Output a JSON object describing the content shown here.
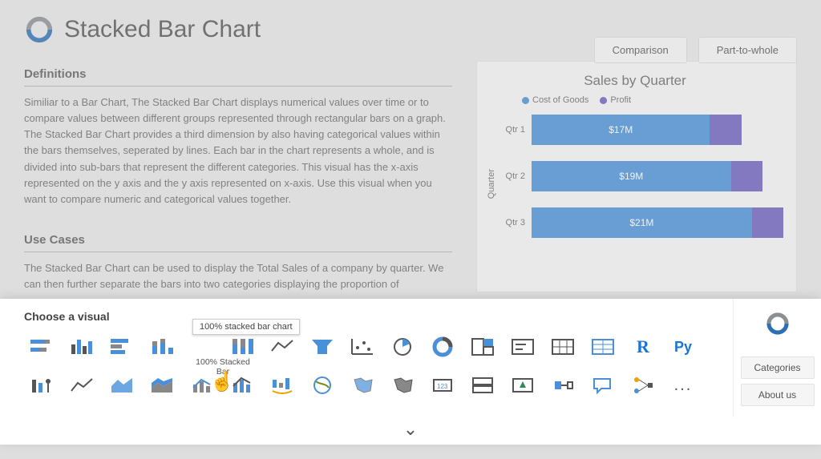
{
  "header": {
    "title": "Stacked Bar Chart",
    "buttons": {
      "comparison": "Comparison",
      "part_to_whole": "Part-to-whole"
    }
  },
  "sections": {
    "definitions_h": "Definitions",
    "definitions_body": "Similiar to a Bar Chart, The Stacked Bar Chart displays numerical values over time or to compare values between different groups represented through rectangular bars on a graph. The Stacked Bar Chart provides a third dimension by also having categorical values within the bars themselves, seperated by lines. Each bar in the chart represents a whole, and is divided into sub-bars that represent the different categories. This visual has the x-axis represented on the y axis and the y axis represented on x-axis. Use this visual when you want to compare numeric and categorical values together.",
    "usecases_h": "Use Cases",
    "usecases_body": "The Stacked Bar Chart can be used to display the Total Sales of a company by quarter. We can then further separate the bars into two categories displaying the proportion of"
  },
  "chooser": {
    "title": "Choose a visual",
    "tooltip": "100% stacked bar chart",
    "hover_label": "100% Stacked Bar",
    "r_label": "R",
    "py_label": "Py",
    "more": "...",
    "side": {
      "categories": "Categories",
      "about": "About us"
    }
  },
  "chart_data": {
    "type": "bar",
    "orientation": "horizontal",
    "stacked": true,
    "title": "Sales by Quarter",
    "ylabel": "Quarter",
    "categories": [
      "Qtr 1",
      "Qtr 2",
      "Qtr 3"
    ],
    "series": [
      {
        "name": "Cost of Goods",
        "color": "#4a90d9",
        "values": [
          17,
          19,
          21
        ],
        "labels": [
          "$17M",
          "$19M",
          "$21M"
        ]
      },
      {
        "name": "Profit",
        "color": "#6b5fbf",
        "values": [
          3,
          3,
          3
        ]
      }
    ]
  }
}
